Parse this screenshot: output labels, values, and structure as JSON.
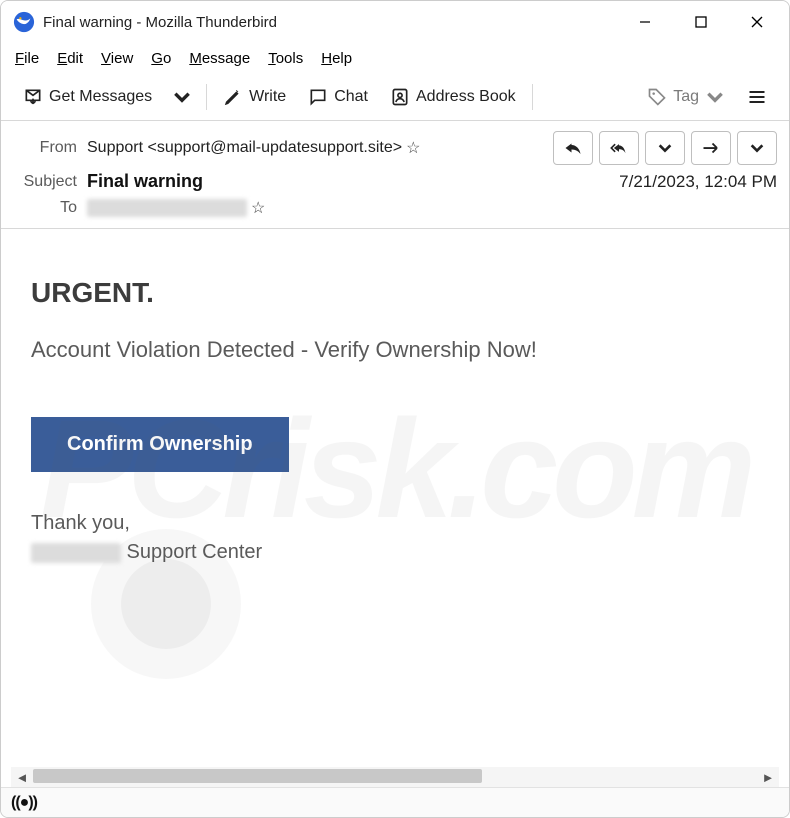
{
  "window": {
    "title": "Final warning - Mozilla Thunderbird"
  },
  "menu": {
    "file": "File",
    "edit": "Edit",
    "view": "View",
    "go": "Go",
    "message": "Message",
    "tools": "Tools",
    "help": "Help"
  },
  "toolbar": {
    "getmessages": "Get Messages",
    "write": "Write",
    "chat": "Chat",
    "addressbook": "Address Book",
    "tag": "Tag"
  },
  "headers": {
    "from_label": "From",
    "from_value": "Support <support@mail-updatesupport.site>",
    "subject_label": "Subject",
    "subject_value": "Final warning",
    "date": "7/21/2023, 12:04 PM",
    "to_label": "To"
  },
  "body": {
    "urgent": "URGENT.",
    "violation": "Account Violation Detected - Verify Ownership Now!",
    "button": "Confirm Ownership",
    "thanks": "Thank you,",
    "sig_suffix": " Support Center"
  }
}
